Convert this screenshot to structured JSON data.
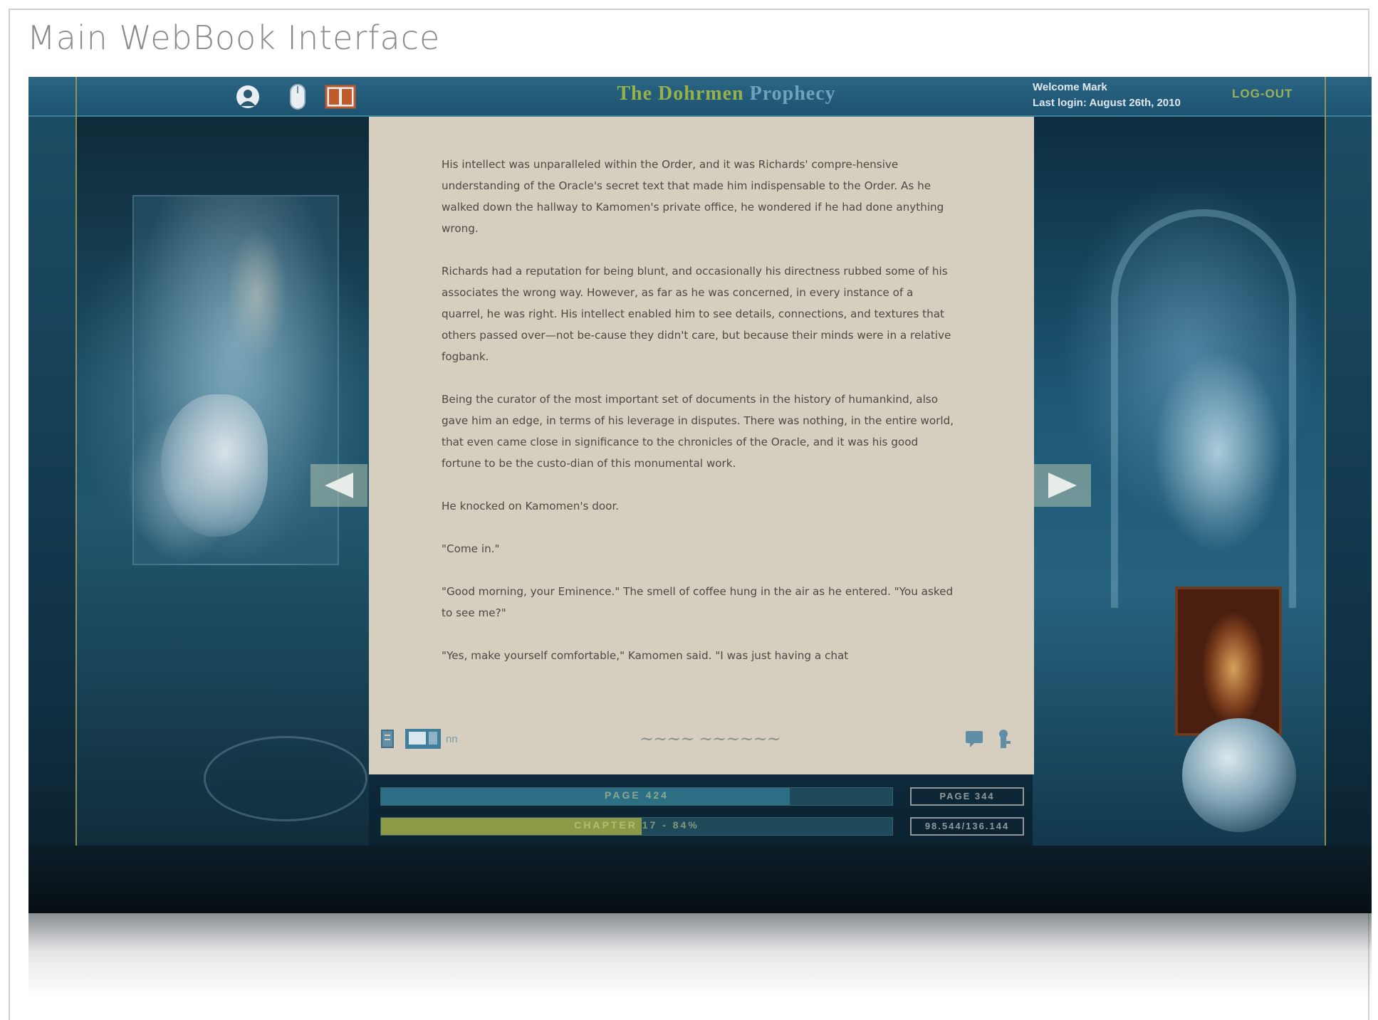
{
  "main_title": "Main WebBook Interface",
  "header": {
    "title_part1": "The Dohrmen",
    "title_part2": "Prophecy",
    "welcome": "Welcome Mark",
    "last_login": "Last login: August 26th, 2010",
    "logout_label": "LOG-OUT",
    "icons": [
      "user-icon",
      "mouse-icon",
      "book-icon"
    ]
  },
  "page": {
    "paragraphs": [
      "His intellect was unparalleled within the Order, and it was Richards' compre-hensive understanding of the Oracle's secret text that made him indispensable to the Order. As he walked down the hallway to Kamomen's private office, he wondered if he had done anything wrong.",
      "Richards had a reputation for being blunt, and occasionally his directness rubbed some of his associates the wrong way. However, as far as he was concerned, in every instance of a quarrel, he was right. His intellect enabled him to see details, connections, and textures that others passed over—not be-cause they didn't care, but because their minds were in a relative fogbank.",
      "Being the curator of the most important set of documents in the history of humankind, also gave him an edge, in terms of his leverage in disputes. There was nothing, in the entire world, that even came close in significance to the chronicles of the Oracle, and it was his good fortune to be the custo-dian of this monumental work.",
      "He knocked on Kamomen's door.",
      "\"Come in.\"",
      "\"Good morning, your Eminence.\" The smell of coffee hung in the air as he entered. \"You asked to see me?\"",
      "\"Yes, make yourself comfortable,\" Kamomen said. \"I was just having a chat"
    ],
    "footer_icons": [
      "page-icon",
      "note-icon",
      "bookmark-icon"
    ],
    "footer_small_label": "nn",
    "signature": "~~~~ ~~~~~~"
  },
  "progress": {
    "page_label": "PAGE 424",
    "page_fill": 0.8,
    "page_box": "PAGE 344",
    "chapter_label": "CHAPTER 17 - 84%",
    "chapter_fill": 0.51,
    "chapter_box": "98.544/136.144"
  },
  "colors": {
    "page_bg": "#d6cfbf",
    "title_green": "#97b24a",
    "title_blue": "#6fa3bd",
    "chapter_fill": "#8c9a45",
    "page_fill": "#2c6f84"
  }
}
